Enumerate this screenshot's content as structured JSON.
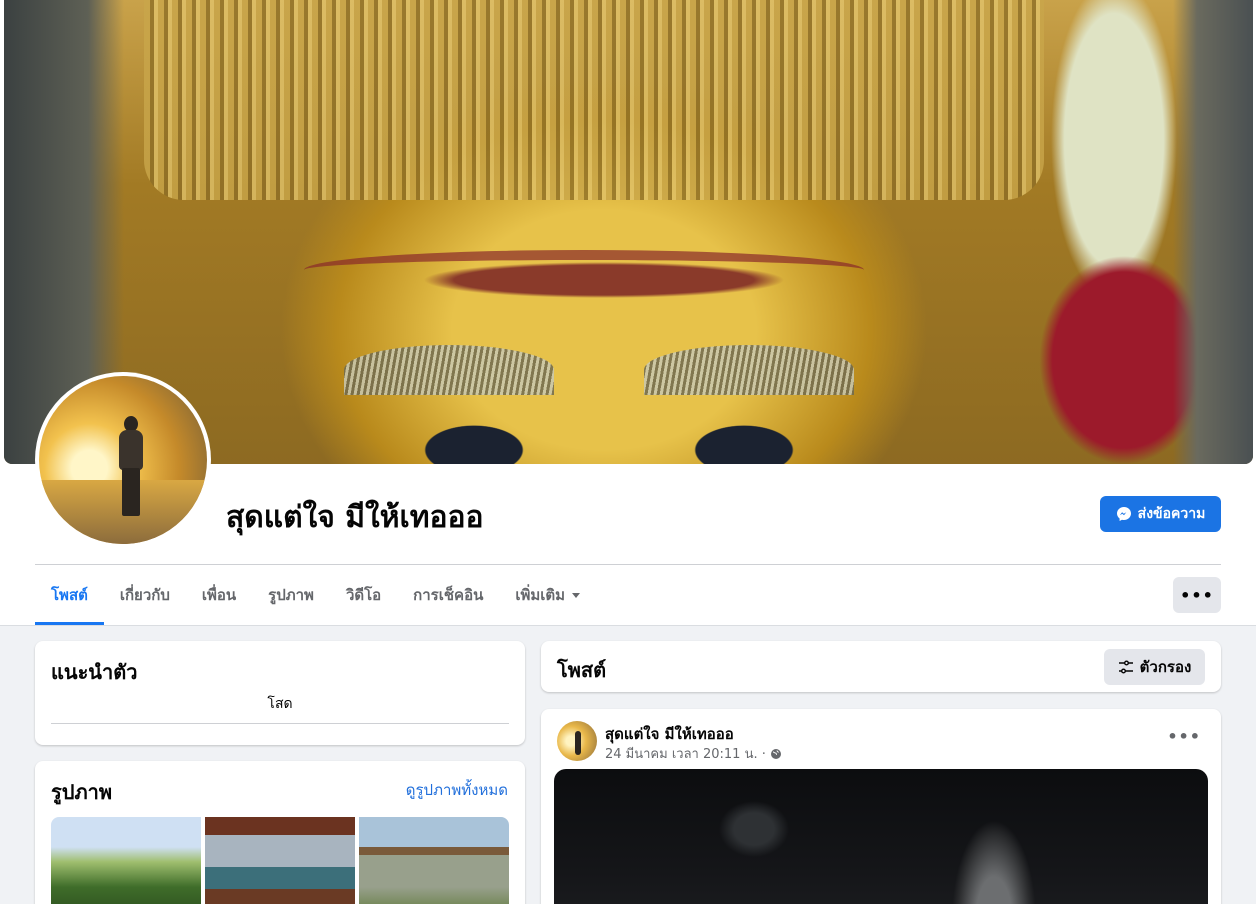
{
  "profile": {
    "name": "สุดแต่ใจ มีให้เทอออ",
    "message_button": "ส่งข้อความ"
  },
  "tabs": [
    {
      "label": "โพสต์",
      "active": true
    },
    {
      "label": "เกี่ยวกับ"
    },
    {
      "label": "เพื่อน"
    },
    {
      "label": "รูปภาพ"
    },
    {
      "label": "วิดีโอ"
    },
    {
      "label": "การเช็คอิน"
    },
    {
      "label": "เพิ่มเติม",
      "dropdown": true
    }
  ],
  "more_button": "•••",
  "intro": {
    "title": "แนะนำตัว",
    "bio": "โสด"
  },
  "photos": {
    "title": "รูปภาพ",
    "see_all": "ดูรูปภาพทั้งหมด"
  },
  "posts": {
    "title": "โพสต์",
    "filter_label": "ตัวกรอง"
  },
  "post": {
    "author": "สุดแต่ใจ มีให้เทอออ",
    "timestamp": "24 มีนาคม เวลา 20:11 น. ·",
    "privacy_icon": "globe-icon",
    "more": "•••"
  },
  "colors": {
    "accent": "#1877f2",
    "button_blue": "#1b74e4",
    "background": "#f0f2f5"
  }
}
